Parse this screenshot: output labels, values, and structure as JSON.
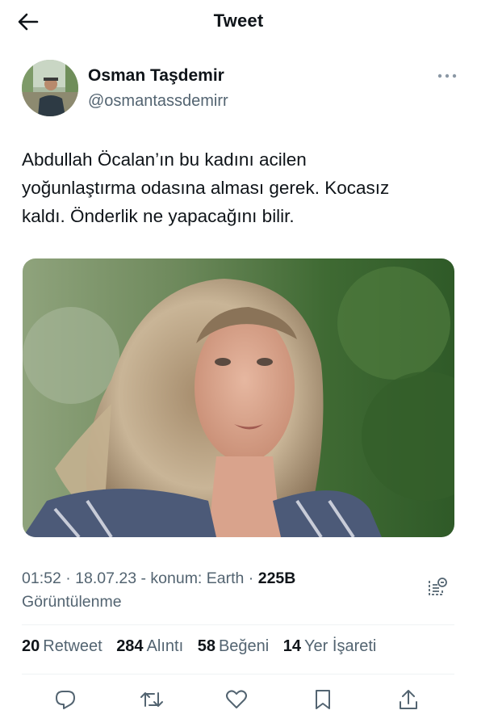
{
  "header": {
    "title": "Tweet"
  },
  "author": {
    "name": "Osman Taşdemir",
    "handle": "@osmantassdemirr"
  },
  "tweet": {
    "lines": [
      "Abdullah Öcalan’ın bu kadını acilen",
      "yoğunlaştırma odasına alması gerek. Kocasız",
      "kaldı. Önderlik ne yapacağını bilir."
    ]
  },
  "meta": {
    "time": "01:52",
    "date": "18.07.23",
    "location": "konum: Earth",
    "views_count": "225B",
    "views_label": "Görüntülenme"
  },
  "stats": {
    "retweets": {
      "count": "20",
      "label": "Retweet"
    },
    "quotes": {
      "count": "284",
      "label": "Alıntı"
    },
    "likes": {
      "count": "58",
      "label": "Beğeni"
    },
    "bookmarks": {
      "count": "14",
      "label": "Yer İşareti"
    }
  },
  "icons": {
    "back": "arrow-left-icon",
    "more": "more-dots-icon",
    "analytics": "analytics-icon",
    "reply": "reply-icon",
    "retweet": "retweet-icon",
    "like": "heart-icon",
    "bookmark": "bookmark-icon",
    "share": "share-icon"
  },
  "colors": {
    "text": "#0f1419",
    "secondary": "#536471",
    "divider": "#eff3f4"
  }
}
